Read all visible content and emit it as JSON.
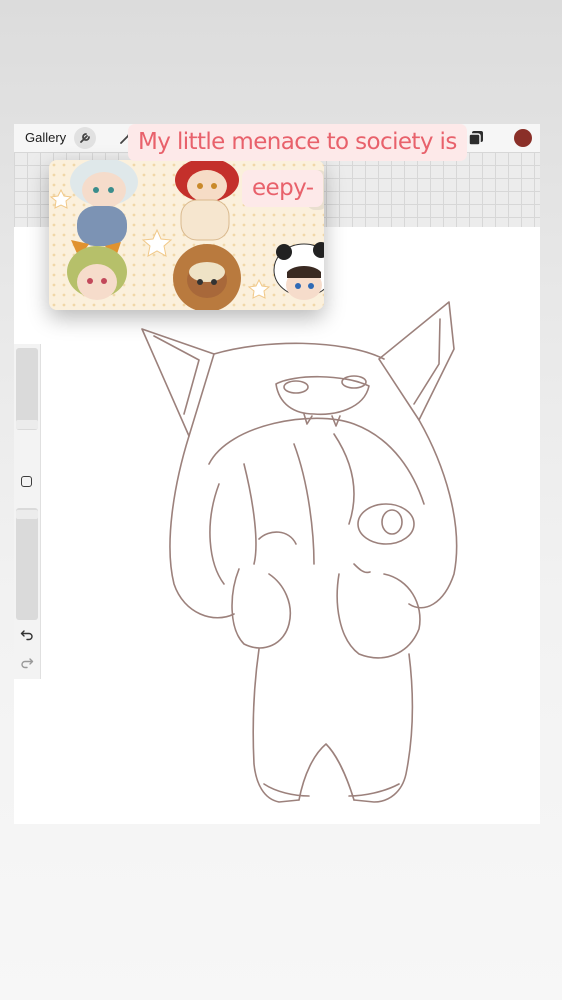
{
  "toolbar": {
    "gallery_label": "Gallery",
    "icons": [
      "wrench-icon",
      "magic-wand-icon",
      "brush-icon",
      "layers-icon",
      "color-swatch"
    ],
    "current_color": "#8a2f28"
  },
  "sidebar": {
    "icons": [
      "modify-button-icon",
      "undo-icon",
      "redo-icon"
    ]
  },
  "caption": {
    "line1": "My little menace to society is",
    "line2": "eepy-",
    "text_color": "#e8616b",
    "background_color": "#fde9e9"
  },
  "overlay": {
    "description_icon": "chibi-reference-image"
  }
}
